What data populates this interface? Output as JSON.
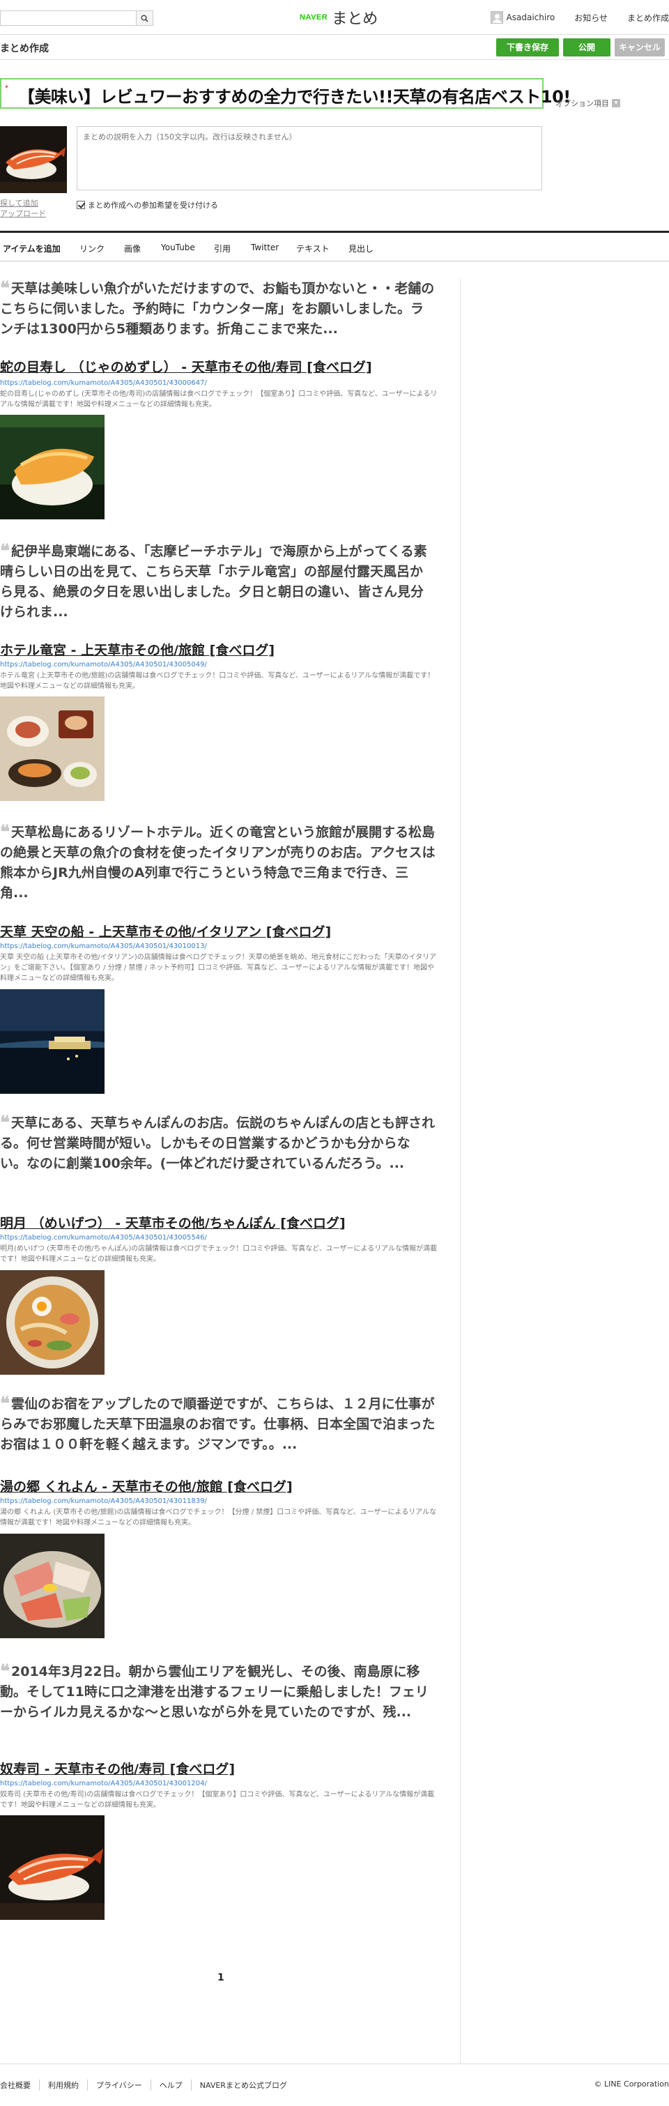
{
  "header": {
    "search_placeholder": "",
    "logo_naver": "NAVER",
    "logo_matome": "まとめ",
    "username": "Asadaichiro",
    "notice": "お知らせ",
    "create": "まとめ作成"
  },
  "createbar": {
    "title": "まとめ作成",
    "draft_button": "下書き保存",
    "publish_button": "公開",
    "cancel_button": "キャンセル"
  },
  "editor": {
    "required_mark": "*",
    "title": "【美味い】レビュワーおすすめの全力で行きたい!!天草の有名店ベスト10!",
    "options_link": "オプション項目",
    "thumb_link_1": "探して追加",
    "thumb_link_2": "アップロード",
    "description_placeholder": "まとめの説明を入力（150文字以内。改行は反映されません）",
    "collab_label": "まとめ作成への参加希望を受け付ける"
  },
  "toolbar": {
    "items": [
      "アイテムを追加",
      "リンク",
      "画像",
      "YouTube",
      "引用",
      "Twitter",
      "テキスト",
      "見出し"
    ]
  },
  "content": {
    "blocks": [
      {
        "quote": "天草は美味しい魚介がいただけますので、お鮨も頂かないと・・老舗のこちらに伺いました。予約時に「カウンター席」をお願いしました。ランチは1300円から5種類あります。折角ここまで来た...",
        "link_title": "蛇の目寿し （じゃのめずし） - 天草市その他/寿司 [食べログ]",
        "link_url": "https://tabelog.com/kumamoto/A4305/A430501/43000647/",
        "link_desc": "蛇の目寿し(じゃのめずし (天草市その他/寿司)の店舗情報は食べログでチェック！【個室あり】口コミや評価、写真など、ユーザーによるリアルな情報が満載です！地図や料理メニューなどの詳細情報も充実。"
      },
      {
        "quote": "紀伊半島東端にある、「志摩ビーチホテル」で海原から上がってくる素晴らしい日の出を見て、こちら天草「ホテル竜宮」の部屋付露天風呂から見る、絶景の夕日を思い出しました。夕日と朝日の違い、皆さん見分けられま...",
        "link_title": "ホテル竜宮 - 上天草市その他/旅館 [食べログ]",
        "link_url": "https://tabelog.com/kumamoto/A4305/A430501/43005049/",
        "link_desc": "ホテル竜宮 (上天草市その他/旅館)の店舗情報は食べログでチェック！口コミや評価、写真など、ユーザーによるリアルな情報が満載です！地図や料理メニューなどの詳細情報も充実。"
      },
      {
        "quote": "天草松島にあるリゾートホテル。近くの竜宮という旅館が展開する松島の絶景と天草の魚介の食材を使ったイタリアンが売りのお店。アクセスは熊本からJR九州自慢のA列車で行こうという特急で三角まで行き、三角...",
        "link_title": "天草 天空の船 - 上天草市その他/イタリアン [食べログ]",
        "link_url": "https://tabelog.com/kumamoto/A4305/A430501/43010013/",
        "link_desc": "天草 天空の船 (上天草市その他/イタリアン)の店舗情報は食べログでチェック！天草の絶景を眺め、地元食材にこだわった「天草のイタリアン」をご堪能下さい。【個室あり / 分煙 / 禁煙 / ネット予約可】口コミや評価、写真など、ユーザーによるリアルな情報が満載です！地図や料理メニューなどの詳細情報も充実。"
      },
      {
        "quote": "天草にある、天草ちゃんぽんのお店。伝説のちゃんぽんの店とも評される。何せ営業時間が短い。しかもその日営業するかどうかも分からない。なのに創業100余年。(一体どれだけ愛されているんだろう。...",
        "link_title": "明月 （めいげつ） - 天草市その他/ちゃんぽん [食べログ]",
        "link_url": "https://tabelog.com/kumamoto/A4305/A430501/43005546/",
        "link_desc": "明月(めいげつ (天草市その他/ちゃんぽん)の店舗情報は食べログでチェック！口コミや評価、写真など、ユーザーによるリアルな情報が満載です！地図や料理メニューなどの詳細情報も充実。"
      },
      {
        "quote": "雲仙のお宿をアップしたので順番逆ですが、こちらは、１２月に仕事がらみでお邪魔した天草下田温泉のお宿です。仕事柄、日本全国で泊まったお宿は１００軒を軽く越えます。ジマンです。。...",
        "link_title": "湯の郷 くれよん - 天草市その他/旅館 [食べログ]",
        "link_url": "https://tabelog.com/kumamoto/A4305/A430501/43011839/",
        "link_desc": "湯の郷 くれよん (天草市その他/旅館)の店舗情報は食べログでチェック！【分煙 / 禁煙】口コミや評価、写真など、ユーザーによるリアルな情報が満載です！地図や料理メニューなどの詳細情報も充実。"
      },
      {
        "quote": "2014年3月22日。朝から雲仙エリアを観光し、その後、南島原に移動。そして11時に口之津港を出港するフェリーに乗船しました！フェリーからイルカ見えるかな〜と思いながら外を見ていたのですが、残...",
        "link_title": "奴寿司 - 天草市その他/寿司 [食べログ]",
        "link_url": "https://tabelog.com/kumamoto/A4305/A430501/43001204/",
        "link_desc": "奴寿司 (天草市その他/寿司)の店舗情報は食べログでチェック！【個室あり】口コミや評価、写真など、ユーザーによるリアルな情報が満載です！地図や料理メニューなどの詳細情報も充実。"
      }
    ],
    "page": "1"
  },
  "footer": {
    "links": [
      "会社概要",
      "利用規約",
      "プライバシー",
      "ヘルプ",
      "NAVERまとめ公式ブログ"
    ],
    "copyright": "© LINE Corporation"
  }
}
